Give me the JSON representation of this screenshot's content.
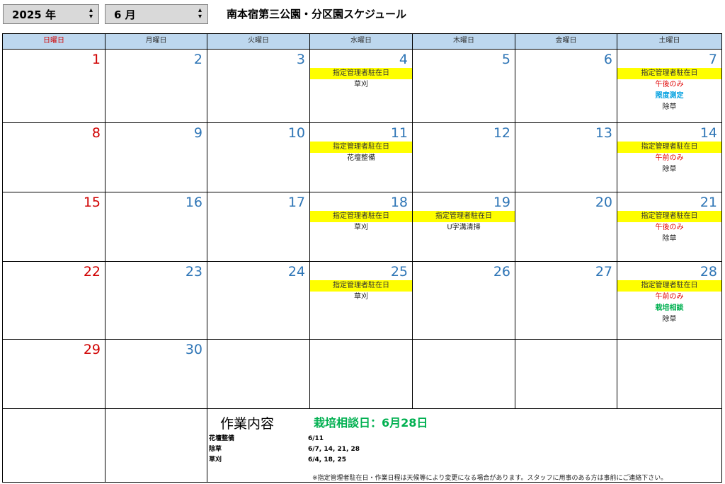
{
  "header": {
    "year_label": "2025 年",
    "month_label": "6 月",
    "spin_icon": "⌃⌄",
    "title": "南本宿第三公園・分区園スケジュール"
  },
  "weekdays": [
    "日曜日",
    "月曜日",
    "火曜日",
    "水曜日",
    "木曜日",
    "金曜日",
    "土曜日"
  ],
  "weeks": [
    [
      {
        "day": "1",
        "events": []
      },
      {
        "day": "2",
        "events": []
      },
      {
        "day": "3",
        "events": []
      },
      {
        "day": "4",
        "events": [
          {
            "text": "指定管理者駐在日",
            "style": "mgr"
          },
          {
            "text": "草刈",
            "style": "plain"
          }
        ]
      },
      {
        "day": "5",
        "events": []
      },
      {
        "day": "6",
        "events": []
      },
      {
        "day": "7",
        "events": [
          {
            "text": "指定管理者駐在日",
            "style": "mgr"
          },
          {
            "text": "午後のみ",
            "style": "red"
          },
          {
            "text": "照度測定",
            "style": "blue"
          },
          {
            "text": "除草",
            "style": "plain"
          }
        ]
      }
    ],
    [
      {
        "day": "8",
        "events": []
      },
      {
        "day": "9",
        "events": []
      },
      {
        "day": "10",
        "events": []
      },
      {
        "day": "11",
        "events": [
          {
            "text": "指定管理者駐在日",
            "style": "mgr"
          },
          {
            "text": "花壇整備",
            "style": "plain"
          }
        ]
      },
      {
        "day": "12",
        "events": []
      },
      {
        "day": "13",
        "events": []
      },
      {
        "day": "14",
        "events": [
          {
            "text": "指定管理者駐在日",
            "style": "mgr"
          },
          {
            "text": "午前のみ",
            "style": "red"
          },
          {
            "text": "除草",
            "style": "plain"
          }
        ]
      }
    ],
    [
      {
        "day": "15",
        "events": []
      },
      {
        "day": "16",
        "events": []
      },
      {
        "day": "17",
        "events": []
      },
      {
        "day": "18",
        "events": [
          {
            "text": "指定管理者駐在日",
            "style": "mgr"
          },
          {
            "text": "草刈",
            "style": "plain"
          }
        ]
      },
      {
        "day": "19",
        "events": [
          {
            "text": "指定管理者駐在日",
            "style": "mgr"
          },
          {
            "text": "U字溝清掃",
            "style": "plain"
          }
        ]
      },
      {
        "day": "20",
        "events": []
      },
      {
        "day": "21",
        "events": [
          {
            "text": "指定管理者駐在日",
            "style": "mgr"
          },
          {
            "text": "午後のみ",
            "style": "red"
          },
          {
            "text": "除草",
            "style": "plain"
          }
        ]
      }
    ],
    [
      {
        "day": "22",
        "events": []
      },
      {
        "day": "23",
        "events": []
      },
      {
        "day": "24",
        "events": []
      },
      {
        "day": "25",
        "events": [
          {
            "text": "指定管理者駐在日",
            "style": "mgr"
          },
          {
            "text": "草刈",
            "style": "plain"
          }
        ]
      },
      {
        "day": "26",
        "events": []
      },
      {
        "day": "27",
        "events": []
      },
      {
        "day": "28",
        "events": [
          {
            "text": "指定管理者駐在日",
            "style": "mgr"
          },
          {
            "text": "午前のみ",
            "style": "red"
          },
          {
            "text": "栽培相談",
            "style": "green"
          },
          {
            "text": "除草",
            "style": "plain"
          }
        ]
      }
    ],
    [
      {
        "day": "29",
        "events": []
      },
      {
        "day": "30",
        "events": []
      },
      {
        "day": "",
        "events": []
      },
      {
        "day": "",
        "events": []
      },
      {
        "day": "",
        "events": []
      },
      {
        "day": "",
        "events": []
      },
      {
        "day": "",
        "events": []
      }
    ]
  ],
  "work": {
    "title": "作業内容",
    "consult": "栽培相談日：6月28日",
    "items": [
      {
        "name": "花壇整備",
        "dates": "6/11"
      },
      {
        "name": "除草",
        "dates": "6/7, 14, 21, 28"
      },
      {
        "name": "草刈",
        "dates": "6/4, 18, 25"
      }
    ],
    "note": "※指定管理者駐在日・作業日程は天候等により変更になる場合があります。スタッフに用事のある方は事前にご連絡下さい。"
  },
  "colors": {
    "header_bg": "#bdd7ee",
    "sunday": "#d00000",
    "weekday_number": "#2e75b6",
    "manager_highlight": "#ffff00",
    "consult_green": "#00b050"
  }
}
